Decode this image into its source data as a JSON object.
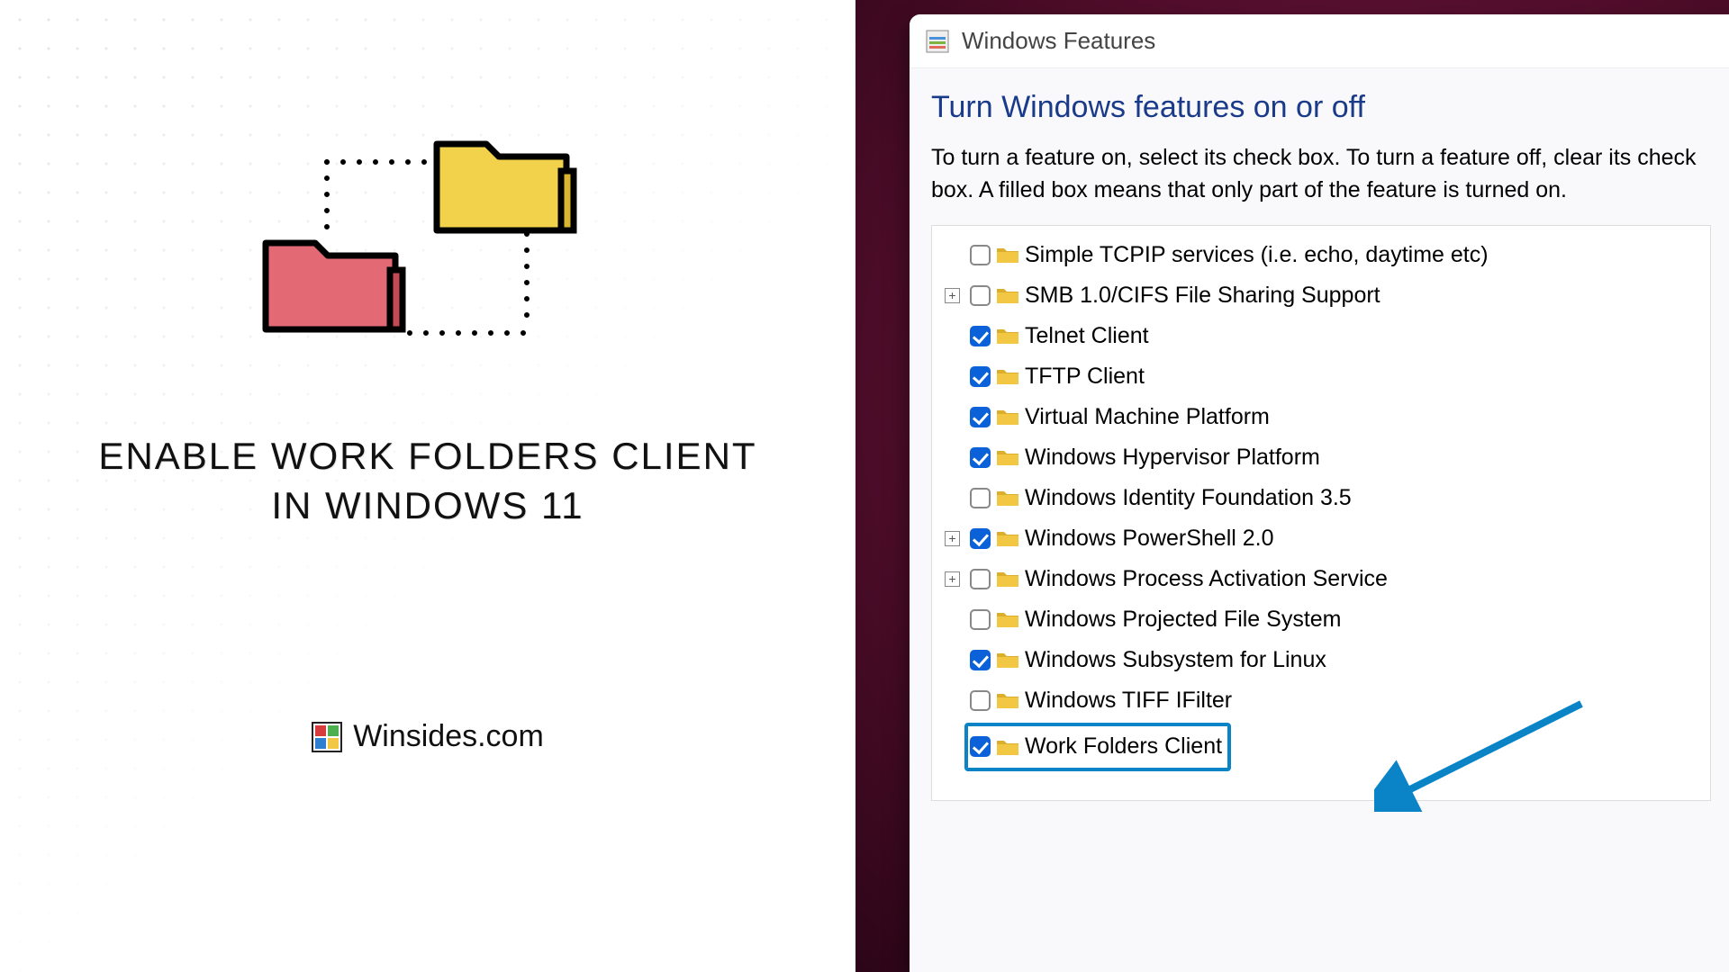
{
  "left": {
    "headline_line1": "ENABLE WORK FOLDERS CLIENT",
    "headline_line2": "IN WINDOWS 11",
    "brand": "Winsides.com"
  },
  "dialog": {
    "title": "Windows Features",
    "heading": "Turn Windows features on or off",
    "description": "To turn a feature on, select its check box. To turn a feature off, clear its check box. A filled box means that only part of the feature is turned on."
  },
  "features": [
    {
      "label": "Simple TCPIP services (i.e. echo, daytime etc)",
      "checked": false,
      "expandable": false,
      "highlighted": false
    },
    {
      "label": "SMB 1.0/CIFS File Sharing Support",
      "checked": false,
      "expandable": true,
      "highlighted": false
    },
    {
      "label": "Telnet Client",
      "checked": true,
      "expandable": false,
      "highlighted": false
    },
    {
      "label": "TFTP Client",
      "checked": true,
      "expandable": false,
      "highlighted": false
    },
    {
      "label": "Virtual Machine Platform",
      "checked": true,
      "expandable": false,
      "highlighted": false
    },
    {
      "label": "Windows Hypervisor Platform",
      "checked": true,
      "expandable": false,
      "highlighted": false
    },
    {
      "label": "Windows Identity Foundation 3.5",
      "checked": false,
      "expandable": false,
      "highlighted": false
    },
    {
      "label": "Windows PowerShell 2.0",
      "checked": true,
      "expandable": true,
      "highlighted": false
    },
    {
      "label": "Windows Process Activation Service",
      "checked": false,
      "expandable": true,
      "highlighted": false
    },
    {
      "label": "Windows Projected File System",
      "checked": false,
      "expandable": false,
      "highlighted": false
    },
    {
      "label": "Windows Subsystem for Linux",
      "checked": true,
      "expandable": false,
      "highlighted": false
    },
    {
      "label": "Windows TIFF IFilter",
      "checked": false,
      "expandable": false,
      "highlighted": false
    },
    {
      "label": "Work Folders Client",
      "checked": true,
      "expandable": false,
      "highlighted": true
    }
  ],
  "colors": {
    "accent_blue": "#0b61d8",
    "highlight_border": "#0a84c7",
    "heading_blue": "#1a3a8a"
  }
}
